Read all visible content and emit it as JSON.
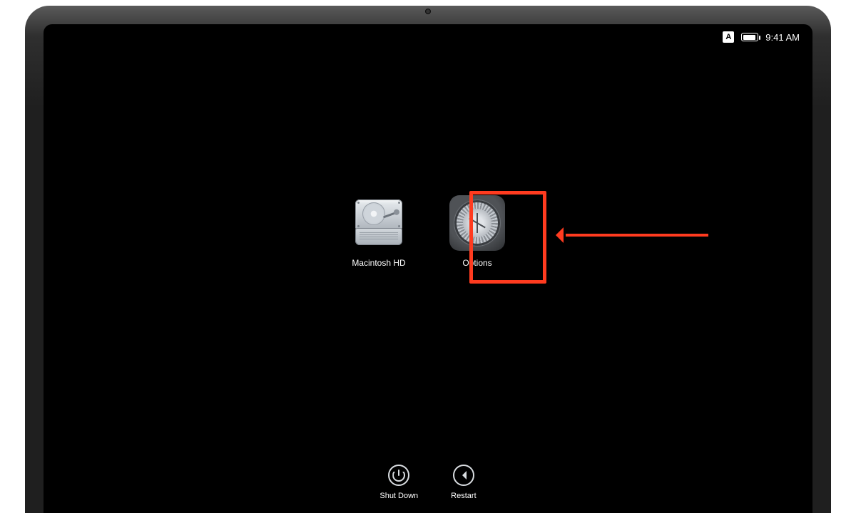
{
  "status": {
    "input_indicator": "A",
    "clock": "9:41 AM"
  },
  "boot_items": [
    {
      "id": "macintosh-hd",
      "label": "Macintosh HD"
    },
    {
      "id": "options",
      "label": "Options"
    }
  ],
  "controls": {
    "shutdown_label": "Shut Down",
    "restart_label": "Restart"
  },
  "annotation": {
    "highlight_color": "#ff3b1f",
    "highlighted_item": "options"
  }
}
